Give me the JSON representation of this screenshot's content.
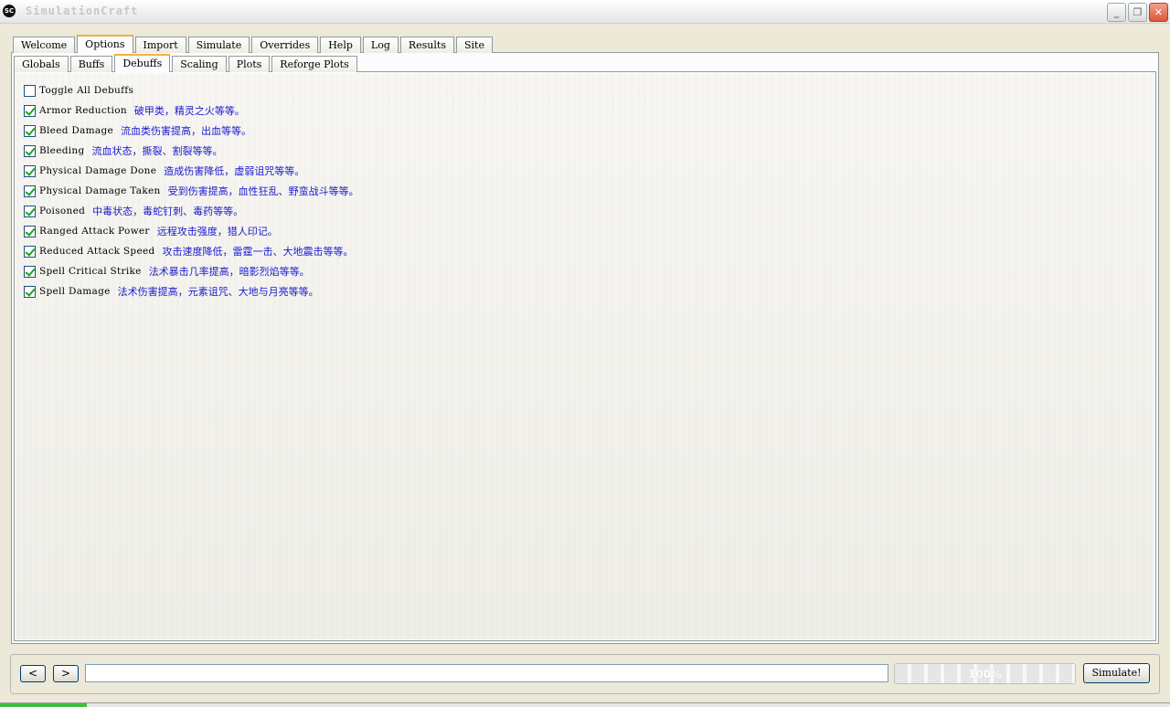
{
  "window": {
    "title": "SimulationCraft",
    "icon_text": "SC",
    "minimize": "_",
    "maximize": "❐",
    "close": "✕"
  },
  "main_tabs": [
    "Welcome",
    "Options",
    "Import",
    "Simulate",
    "Overrides",
    "Help",
    "Log",
    "Results",
    "Site"
  ],
  "main_active": "Options",
  "sub_tabs": [
    "Globals",
    "Buffs",
    "Debuffs",
    "Scaling",
    "Plots",
    "Reforge Plots"
  ],
  "sub_active": "Debuffs",
  "debuffs": [
    {
      "label": "Toggle All Debuffs",
      "desc": "",
      "checked": false
    },
    {
      "label": "Armor Reduction",
      "desc": "破甲类，精灵之火等等。",
      "checked": true
    },
    {
      "label": "Bleed Damage",
      "desc": "流血类伤害提高，出血等等。",
      "checked": true
    },
    {
      "label": "Bleeding",
      "desc": "流血状态，撕裂、割裂等等。",
      "checked": true
    },
    {
      "label": "Physical Damage Done",
      "desc": "造成伤害降低，虚弱诅咒等等。",
      "checked": true
    },
    {
      "label": "Physical Damage Taken",
      "desc": "受到伤害提高，血性狂乱、野蛮战斗等等。",
      "checked": true
    },
    {
      "label": "Poisoned",
      "desc": "中毒状态，毒蛇钉刺、毒药等等。",
      "checked": true
    },
    {
      "label": "Ranged Attack Power",
      "desc": "远程攻击强度，猎人印记。",
      "checked": true
    },
    {
      "label": "Reduced Attack Speed",
      "desc": "攻击速度降低，雷霆一击、大地震击等等。",
      "checked": true
    },
    {
      "label": "Spell Critical Strike",
      "desc": "法术暴击几率提高，暗影烈焰等等。",
      "checked": true
    },
    {
      "label": "Spell Damage",
      "desc": "法术伤害提高，元素诅咒、大地与月亮等等。",
      "checked": true
    }
  ],
  "bottom": {
    "back_label": "<",
    "forward_label": ">",
    "url_value": "",
    "progress_text": "100%",
    "progress_fraction": 1.0,
    "simulate_label": "Simulate!"
  }
}
